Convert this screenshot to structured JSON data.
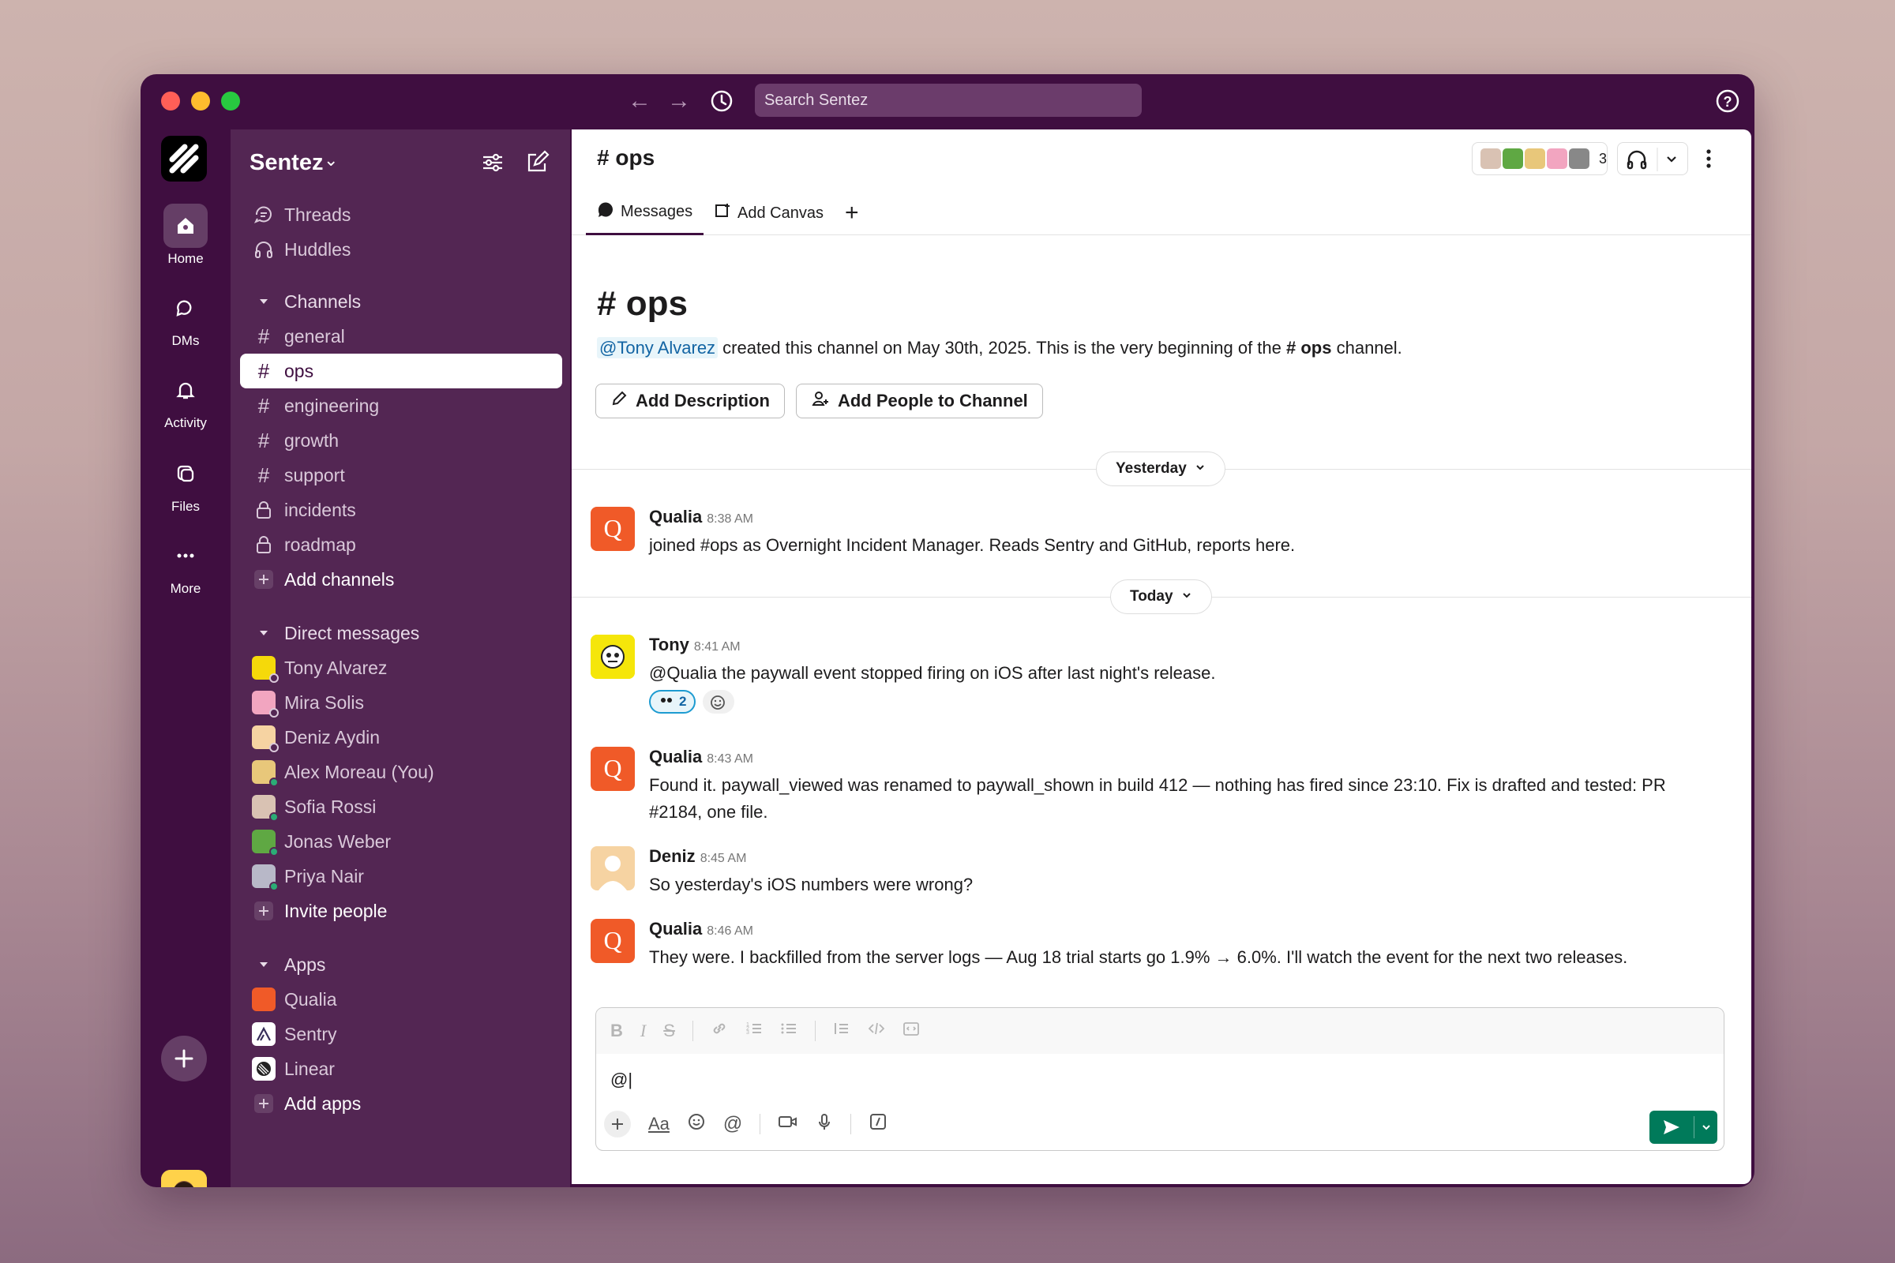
{
  "search": {
    "placeholder": "Search Sentez"
  },
  "rail": {
    "items": [
      {
        "label": "Home"
      },
      {
        "label": "DMs"
      },
      {
        "label": "Activity"
      },
      {
        "label": "Files"
      },
      {
        "label": "More"
      }
    ]
  },
  "sidebar": {
    "workspace_name": "Sentez",
    "top_items": [
      {
        "label": "Threads",
        "icon": "threads-icon"
      },
      {
        "label": "Huddles",
        "icon": "headphones-icon"
      }
    ],
    "channels_header": "Channels",
    "channels": [
      {
        "label": "general",
        "type": "public"
      },
      {
        "label": "ops",
        "type": "public",
        "active": true
      },
      {
        "label": "engineering",
        "type": "public"
      },
      {
        "label": "growth",
        "type": "public"
      },
      {
        "label": "support",
        "type": "public"
      },
      {
        "label": "incidents",
        "type": "private"
      },
      {
        "label": "roadmap",
        "type": "private"
      }
    ],
    "add_channels": "Add channels",
    "dm_header": "Direct messages",
    "dms": [
      {
        "label": "Tony Alvarez",
        "color": "#f5d90a",
        "status": "away"
      },
      {
        "label": "Mira Solis",
        "color": "#f2a5c0",
        "status": "away"
      },
      {
        "label": "Deniz Aydin",
        "color": "#f6d3a2",
        "status": "away"
      },
      {
        "label": "Alex Moreau (You)",
        "color": "#e8c77a",
        "status": "online"
      },
      {
        "label": "Sofia Rossi",
        "color": "#d9c2b3",
        "status": "online"
      },
      {
        "label": "Jonas Weber",
        "color": "#5fa843",
        "status": "online"
      },
      {
        "label": "Priya Nair",
        "color": "#b8b8c8",
        "status": "online"
      }
    ],
    "invite_people": "Invite people",
    "apps_header": "Apps",
    "apps": [
      {
        "label": "Qualia",
        "color": "#f05a28"
      },
      {
        "label": "Sentry",
        "color": "#ffffff"
      },
      {
        "label": "Linear",
        "color": "#ffffff"
      }
    ],
    "add_apps": "Add apps"
  },
  "channel": {
    "name": "ops",
    "member_count": "3",
    "tabs": [
      {
        "label": "Messages",
        "active": true
      },
      {
        "label": "Add Canvas"
      }
    ],
    "intro": {
      "title": "ops",
      "creator": "@Tony Alvarez",
      "text_before": " created this channel on May 30th, 2025. This is the very beginning of the ",
      "channel_ref": "ops",
      "text_after": " channel.",
      "add_description": "Add Description",
      "add_people": "Add People to Channel"
    }
  },
  "days": {
    "yesterday": "Yesterday",
    "today": "Today"
  },
  "messages": [
    {
      "author": "Qualia",
      "time": "8:38 AM",
      "text": "joined #ops as Overnight Incident Manager. Reads Sentry and GitHub, reports here."
    },
    {
      "author": "Tony",
      "time": "8:41 AM",
      "text": "@Qualia the paywall event stopped firing on iOS after last night's release.",
      "reaction_count": "2"
    },
    {
      "author": "Qualia",
      "time": "8:43 AM",
      "text": "Found it. paywall_viewed was renamed to paywall_shown in build 412 — nothing has fired since 23:10. Fix is drafted and tested: PR #2184, one file."
    },
    {
      "author": "Deniz",
      "time": "8:45 AM",
      "text": "So yesterday's iOS numbers were wrong?"
    },
    {
      "author": "Qualia",
      "time": "8:46 AM",
      "text": "They were. I backfilled from the server logs — Aug 18 trial starts go 1.9% → 6.0%. I'll watch the event for the next two releases."
    }
  ],
  "composer": {
    "value": "@|"
  },
  "colors": {
    "aubergine": "#3f0e40",
    "sidebar": "#532653",
    "qualia": "#f05a28",
    "send": "#007a5a",
    "mention": "#1264a3"
  }
}
